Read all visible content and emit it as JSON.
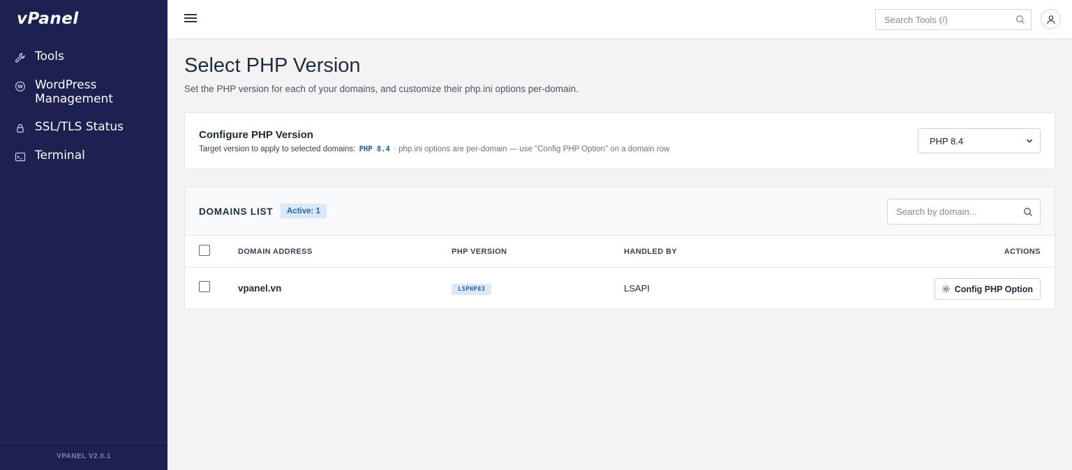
{
  "sidebar": {
    "logo": "vPanel",
    "items": [
      {
        "label": "Tools",
        "icon": "wrench-icon"
      },
      {
        "label": "WordPress Management",
        "icon": "wordpress-icon"
      },
      {
        "label": "SSL/TLS Status",
        "icon": "lock-icon"
      },
      {
        "label": "Terminal",
        "icon": "terminal-icon"
      }
    ],
    "version": "VPANEL V2.0.1"
  },
  "topbar": {
    "search_placeholder": "Search Tools (/)"
  },
  "page": {
    "title": "Select PHP Version",
    "subtitle": "Set the PHP version for each of your domains, and customize their php.ini options per-domain."
  },
  "configure": {
    "title": "Configure PHP Version",
    "desc_prefix": "Target version to apply to selected domains:",
    "target_version_code": "PHP 8.4",
    "desc_suffix": "· php.ini options are per-domain — use \"Config PHP Option\" on a domain row",
    "selected_version": "PHP 8.4"
  },
  "domains": {
    "title": "DOMAINS LIST",
    "active_badge": "Active: 1",
    "search_placeholder": "Search by domain...",
    "columns": {
      "domain": "DOMAIN ADDRESS",
      "php": "PHP VERSION",
      "handler": "HANDLED BY",
      "actions": "ACTIONS"
    },
    "rows": [
      {
        "domain": "vpanel.vn",
        "php": "LSPHP83",
        "handler": "LSAPI",
        "action": "Config PHP Option"
      }
    ]
  },
  "colors": {
    "sidebar_bg": "#1d2151",
    "badge_bg": "#dbe8f7",
    "badge_text": "#2563aa"
  }
}
